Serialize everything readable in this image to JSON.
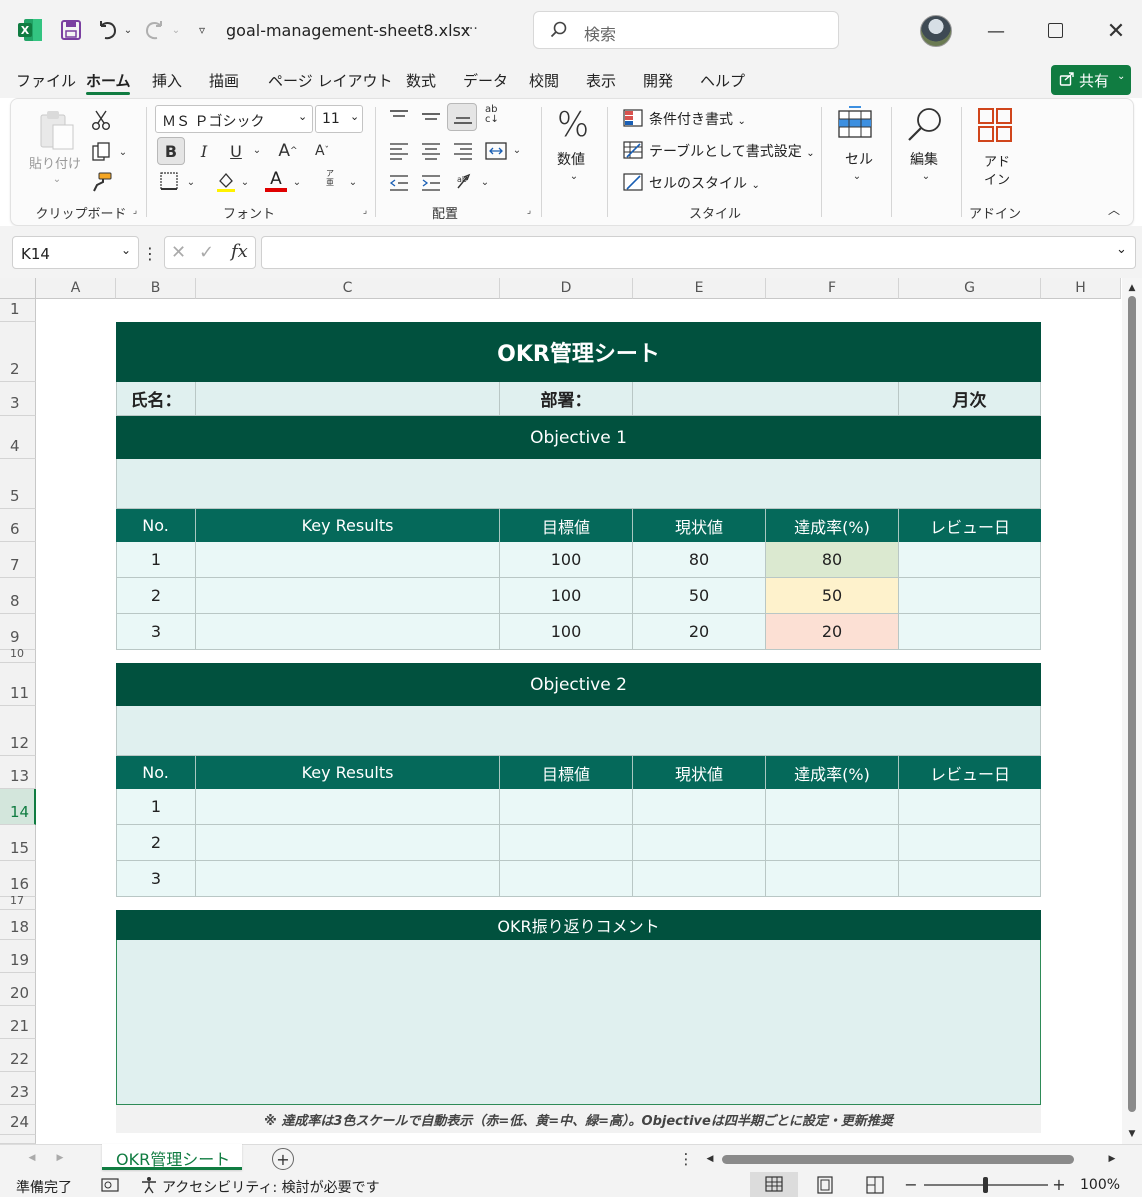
{
  "app": {
    "excel_icon": "excel-logo-icon",
    "filename": "goal-management-sheet8.xlsx",
    "filename_more": "····",
    "search_placeholder": "検索"
  },
  "menu_tabs": [
    "ファイル",
    "ホーム",
    "挿入",
    "描画",
    "ページ レイアウト",
    "数式",
    "データ",
    "校閲",
    "表示",
    "開発",
    "ヘルプ"
  ],
  "share_label": "共有",
  "ribbon": {
    "clipboard": {
      "paste": "貼り付け",
      "group": "クリップボード"
    },
    "font": {
      "name": "ＭＳ Ｐゴシック",
      "size": "11",
      "group": "フォント",
      "bold": "B",
      "italic": "I",
      "underline": "U",
      "grow": "A",
      "shrink": "A",
      "font_color": "A"
    },
    "alignment": {
      "group": "配置"
    },
    "number": {
      "label": "数値",
      "pct": "%"
    },
    "styles": {
      "cond": "条件付き書式",
      "table": "テーブルとして書式設定",
      "cell": "セルのスタイル",
      "group": "スタイル"
    },
    "cells": {
      "label": "セル"
    },
    "editing": {
      "label": "編集"
    },
    "addin": {
      "label1": "アド",
      "label2": "イン",
      "group": "アドイン"
    }
  },
  "formula_bar": {
    "name_box": "K14",
    "fx": "fx",
    "formula": ""
  },
  "columns": [
    "A",
    "B",
    "C",
    "D",
    "E",
    "F",
    "G",
    "H"
  ],
  "rows": [
    "1",
    "2",
    "3",
    "4",
    "5",
    "6",
    "7",
    "8",
    "9",
    "10",
    "11",
    "12",
    "13",
    "14",
    "15",
    "16",
    "17",
    "18",
    "19",
    "20",
    "21",
    "22",
    "23",
    "24"
  ],
  "sheet": {
    "title": "OKR管理シート",
    "name_label": "氏名：",
    "dept_label": "部署：",
    "period": "月次",
    "objective1": "Objective 1",
    "objective2": "Objective 2",
    "headers": [
      "No.",
      "Key Results",
      "目標値",
      "現状値",
      "達成率(%)",
      "レビュー日"
    ],
    "obj1_rows": [
      {
        "no": "1",
        "kr": "",
        "target": "100",
        "current": "80",
        "rate": "80",
        "review": ""
      },
      {
        "no": "2",
        "kr": "",
        "target": "100",
        "current": "50",
        "rate": "50",
        "review": ""
      },
      {
        "no": "3",
        "kr": "",
        "target": "100",
        "current": "20",
        "rate": "20",
        "review": ""
      }
    ],
    "obj2_rows": [
      {
        "no": "1",
        "kr": "",
        "target": "",
        "current": "",
        "rate": "",
        "review": ""
      },
      {
        "no": "2",
        "kr": "",
        "target": "",
        "current": "",
        "rate": "",
        "review": ""
      },
      {
        "no": "3",
        "kr": "",
        "target": "",
        "current": "",
        "rate": "",
        "review": ""
      }
    ],
    "comment_header": "OKR振り返りコメント",
    "note": "※ 達成率は3色スケールで自動表示（赤=低、黄=中、緑=高）。Objectiveは四半期ごとに設定・更新推奨"
  },
  "sheet_tab": "OKR管理シート",
  "status": {
    "ready": "準備完了",
    "accessibility": "アクセシビリティ: 検討が必要です",
    "zoom": "100%"
  },
  "colors": {
    "dark_green": "#01513e",
    "mid_green": "#05695a",
    "pale": "#e0f0ef",
    "rate_high": "#dbe9d0",
    "rate_mid": "#fef2cc",
    "rate_low": "#fce0d4",
    "excel_green": "#107c41"
  }
}
